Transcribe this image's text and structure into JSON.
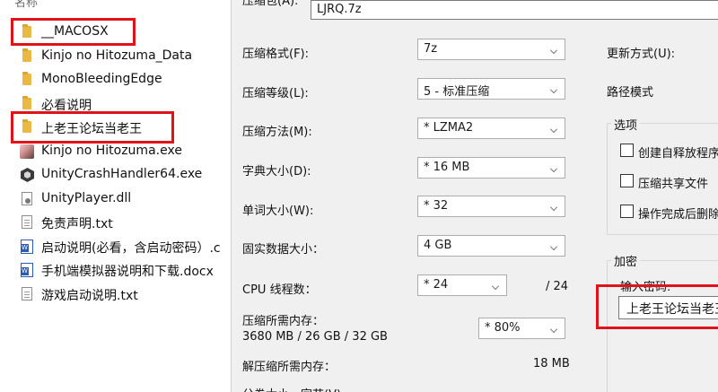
{
  "explorer": {
    "header": "名称",
    "files": [
      {
        "name": "__MACOSX",
        "icon": "folder-icon"
      },
      {
        "name": "Kinjo no Hitozuma_Data",
        "icon": "folder-icon"
      },
      {
        "name": "MonoBleedingEdge",
        "icon": "folder-icon"
      },
      {
        "name": "必看说明",
        "icon": "folder-icon"
      },
      {
        "name": "上老王论坛当老王",
        "icon": "folder-icon"
      },
      {
        "name": "Kinjo no Hitozuma.exe",
        "icon": "app-exe-icon"
      },
      {
        "name": "UnityCrashHandler64.exe",
        "icon": "unity-icon"
      },
      {
        "name": "UnityPlayer.dll",
        "icon": "dll-icon"
      },
      {
        "name": "免责声明.txt",
        "icon": "text-file-icon"
      },
      {
        "name": "启动说明(必看，含启动密码）.c",
        "icon": "word-doc-icon"
      },
      {
        "name": "手机端模拟器说明和下载.docx",
        "icon": "word-doc-icon"
      },
      {
        "name": "游戏启动说明.txt",
        "icon": "text-file-icon"
      }
    ]
  },
  "dialog": {
    "archive_label": "压缩包(A):",
    "archive_name": "LJRQ.7z",
    "format_label": "压缩格式(F):",
    "format_value": "7z",
    "level_label": "压缩等级(L):",
    "level_value": "5 - 标准压缩",
    "method_label": "压缩方法(M):",
    "method_value": "* LZMA2",
    "dict_label": "字典大小(D):",
    "dict_value": "* 16 MB",
    "word_label": "单词大小(W):",
    "word_value": "* 32",
    "solid_label": "固实数据大小：",
    "solid_value": "4 GB",
    "cpu_label": "CPU 线程数：",
    "cpu_value": "* 24",
    "cpu_total": "/ 24",
    "mem_label": "压缩所需内存：",
    "mem_detail": "3680 MB / 26 GB / 32 GB",
    "mem_value": "* 80%",
    "decomp_label": "解压缩所需内存：",
    "decomp_value": "18 MB",
    "cut_label": "分卷大小，字节(V):",
    "update_label": "更新方式(U):",
    "path_label": "路径模式",
    "options_title": "选项",
    "opt_sfx": "创建自释放程序",
    "opt_shared": "压缩共享文件",
    "opt_delete": "操作完成后删除",
    "encrypt_title": "加密",
    "password_label": "输入密码:",
    "password_value": "上老王论坛当老王"
  },
  "colors": {
    "highlight_red": "#e0131b",
    "dialog_bg": "#f0f0f0",
    "folder_yellow": "#e9b845"
  }
}
